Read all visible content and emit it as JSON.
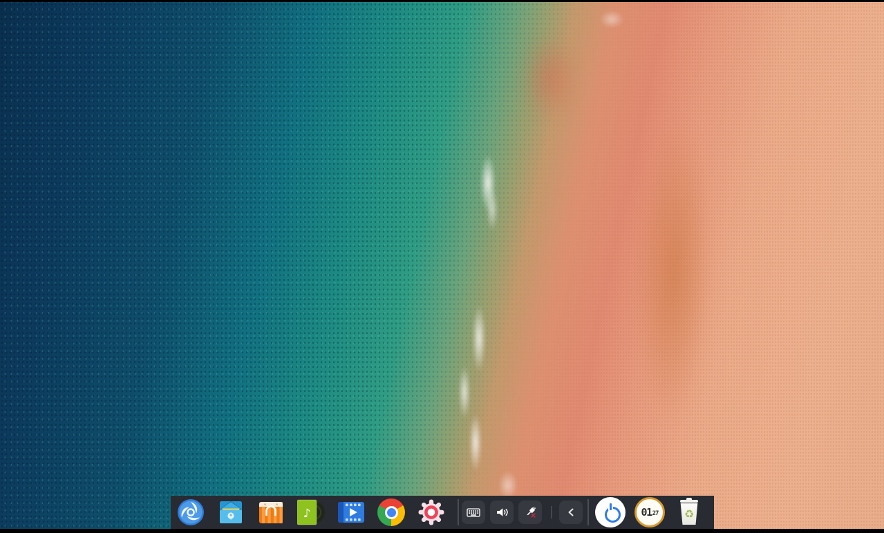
{
  "desktop": {
    "wallpaper_palette": {
      "deep_ocean": "#0c3a5c",
      "teal_water": "#1d8b82",
      "green_shallows": "#2f9c83",
      "sandbar_tan": "#c4996c",
      "coral_wet_sand": "#e18a72",
      "peach_sand": "#ecb08f"
    },
    "top_strip_color": "#000000",
    "bottom_strip_color": "#000000"
  },
  "dock": {
    "background_color": "#282b31",
    "apps": [
      {
        "id": "launcher",
        "icon": "deepin-launcher-icon",
        "accent": "#2f7cd8"
      },
      {
        "id": "file-manager",
        "icon": "file-manager-icon",
        "accent": "#4db7ea"
      },
      {
        "id": "app-store",
        "icon": "app-store-icon",
        "accent": "#f07c18"
      },
      {
        "id": "music",
        "icon": "music-icon",
        "accent": "#8dc21f"
      },
      {
        "id": "movie",
        "icon": "movie-icon",
        "accent": "#2e7ce0"
      },
      {
        "id": "chrome",
        "icon": "chrome-icon",
        "accent": "#4285f4"
      },
      {
        "id": "control-center",
        "icon": "settings-gear-icon",
        "accent": "#ef4458"
      }
    ],
    "tray": [
      {
        "id": "keyboard-layout",
        "icon": "keyboard-icon"
      },
      {
        "id": "sound",
        "icon": "volume-icon"
      },
      {
        "id": "network",
        "icon": "network-disconnected-icon",
        "status_color": "#c0392b"
      }
    ],
    "collapse_button": {
      "icon": "chevron-left-icon"
    },
    "plugins": {
      "shutdown": {
        "icon": "power-icon",
        "accent": "#2d7ce8"
      },
      "clock": {
        "hours": "01",
        "minutes": "27",
        "ring_color": "#d9992e"
      },
      "trash": {
        "icon": "trash-recycle-icon",
        "accent": "#a0bd58"
      }
    }
  }
}
